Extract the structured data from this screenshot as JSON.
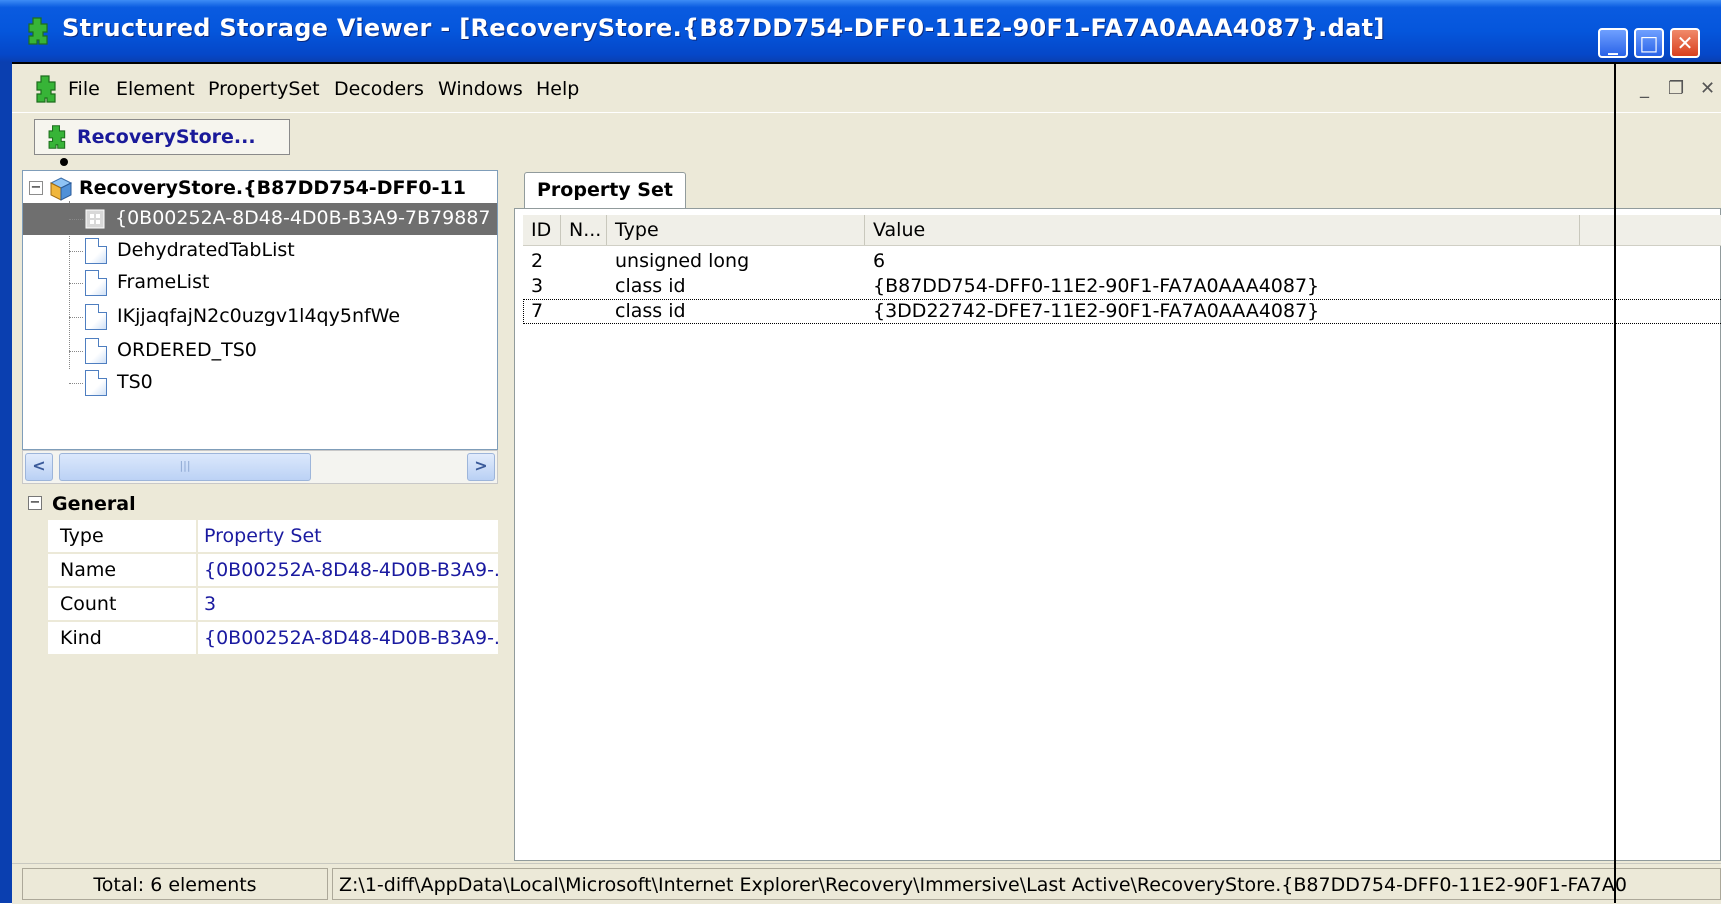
{
  "window": {
    "title": "Structured Storage Viewer - [RecoveryStore.{B87DD754-DFF0-11E2-90F1-FA7A0AAA4087}.dat]",
    "min_glyph": "_",
    "max_glyph": "□",
    "close_glyph": "✕"
  },
  "menu": {
    "items": [
      "File",
      "Element",
      "PropertySet",
      "Decoders",
      "Windows",
      "Help"
    ],
    "mdi_min": "_",
    "mdi_restore": "❐",
    "mdi_close": "✕"
  },
  "toolbar": {
    "doc_tab_label": "RecoveryStore..."
  },
  "tree": {
    "root_label": "RecoveryStore.{B87DD754-DFF0-11",
    "root_expander": "−",
    "items": [
      {
        "label": "{0B00252A-8D48-4D0B-B3A9-7B79887",
        "selected": true,
        "icon": "propertyset-icon"
      },
      {
        "label": "DehydratedTabList",
        "selected": false,
        "icon": "stream-icon"
      },
      {
        "label": "FrameList",
        "selected": false,
        "icon": "stream-icon"
      },
      {
        "label": "IKjjaqfajN2c0uzgv1l4qy5nfWe",
        "selected": false,
        "icon": "stream-icon"
      },
      {
        "label": "ORDERED_TS0",
        "selected": false,
        "icon": "stream-icon"
      },
      {
        "label": "TS0",
        "selected": false,
        "icon": "stream-icon"
      }
    ]
  },
  "hscroll": {
    "left_glyph": "<",
    "right_glyph": ">",
    "thumb_glyph": "|||"
  },
  "properties": {
    "group_label": "General",
    "group_expander": "−",
    "rows": [
      {
        "key": "Type",
        "value": "Property Set"
      },
      {
        "key": "Name",
        "value": "{0B00252A-8D48-4D0B-B3A9-..."
      },
      {
        "key": "Count",
        "value": "3"
      },
      {
        "key": "Kind",
        "value": "{0B00252A-8D48-4D0B-B3A9-..."
      }
    ]
  },
  "property_set": {
    "tab_label": "Property Set",
    "columns": [
      "ID",
      "N...",
      "Type",
      "Value"
    ],
    "rows": [
      {
        "id": "2",
        "name": "",
        "type": "unsigned long",
        "value": "6"
      },
      {
        "id": "3",
        "name": "",
        "type": "class id",
        "value": "{B87DD754-DFF0-11E2-90F1-FA7A0AAA4087}"
      },
      {
        "id": "7",
        "name": "",
        "type": "class id",
        "value": "{3DD22742-DFE7-11E2-90F1-FA7A0AAA4087}"
      }
    ]
  },
  "status": {
    "total": "Total: 6 elements",
    "path": "Z:\\1-diff\\AppData\\Local\\Microsoft\\Internet Explorer\\Recovery\\Immersive\\Last Active\\RecoveryStore.{B87DD754-DFF0-11E2-90F1-FA7A0"
  },
  "colors": {
    "titlebar": "#0556dc",
    "chrome": "#ece9d8",
    "selection": "#6f6f6f",
    "value_text": "#1a1aa0",
    "app_icon": "#2fa82f"
  }
}
